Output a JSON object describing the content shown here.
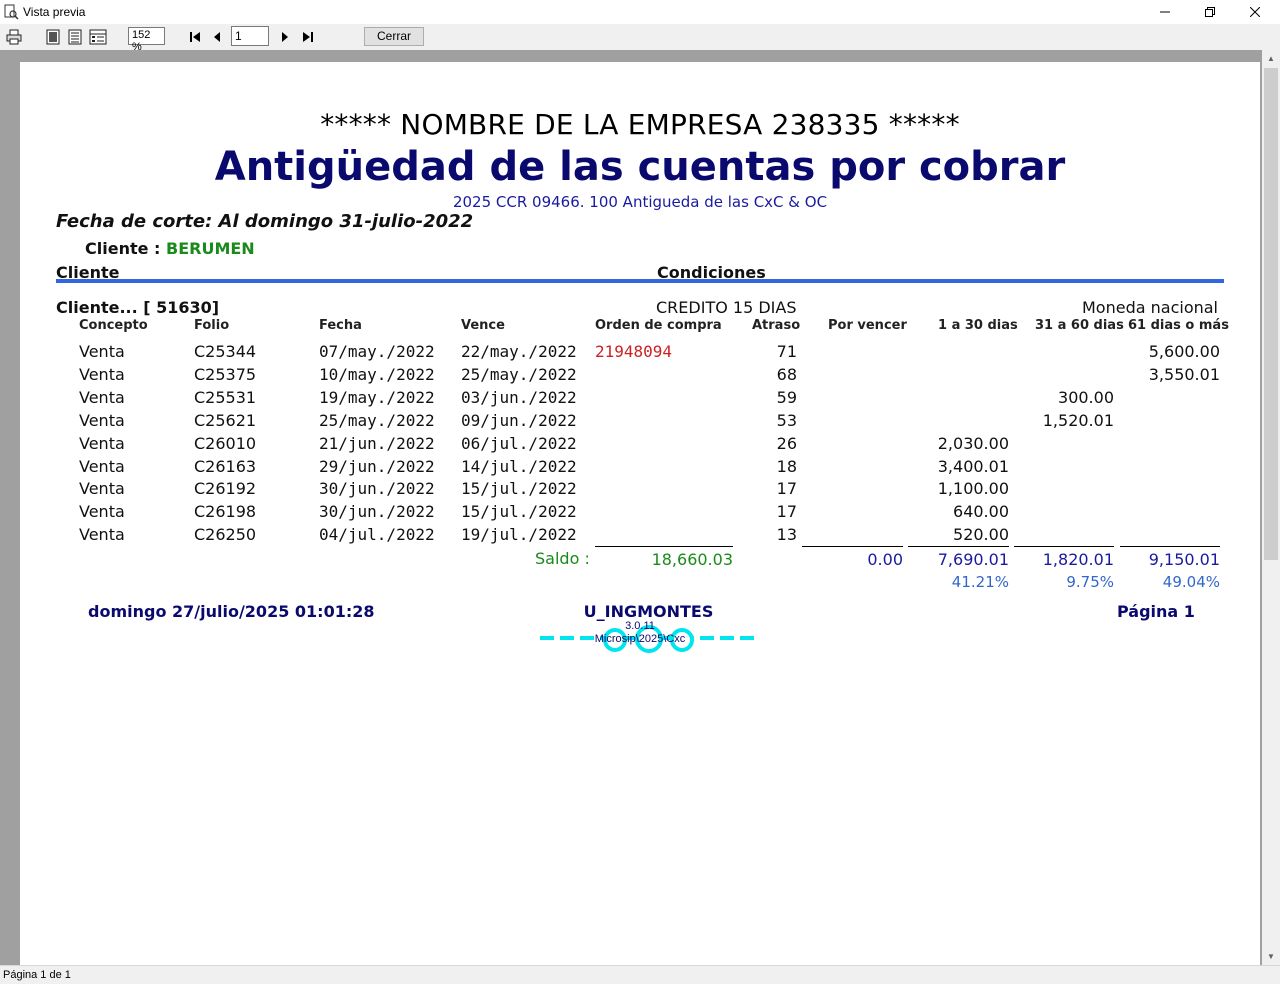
{
  "window": {
    "title": "Vista previa"
  },
  "toolbar": {
    "zoom": "152 %",
    "page_number": "1",
    "close_label": "Cerrar"
  },
  "status": {
    "text": "Página 1 de 1"
  },
  "report": {
    "company": "***** NOMBRE DE LA EMPRESA 238335 *****",
    "title": "Antigüedad de las cuentas por cobrar",
    "subtitle": "2025 CCR 09466. 100 Antigueda de las CxC & OC",
    "cutoff_date": "Fecha de corte: Al domingo 31-julio-2022",
    "client_label": "Cliente :",
    "client_value": "BERUMEN",
    "group_header_client": "Cliente",
    "group_header_conditions": "Condiciones",
    "client_number": "Cliente... [ 51630]",
    "credit_terms": "CREDITO 15 DIAS",
    "currency": "Moneda nacional",
    "columns": [
      "Concepto",
      "Folio",
      "Fecha",
      "Vence",
      "Orden de compra",
      "Atraso",
      "Por vencer",
      "1 a 30 dias",
      "31 a 60 dias",
      "61 dias o más"
    ],
    "rows": [
      {
        "concepto": "Venta",
        "folio": "C25344",
        "fecha": "07/may./2022",
        "vence": "22/may./2022",
        "orden": "21948094",
        "atraso": "71",
        "por_vencer": "",
        "d1_30": "",
        "d31_60": "",
        "d61": "5,600.00"
      },
      {
        "concepto": "Venta",
        "folio": "C25375",
        "fecha": "10/may./2022",
        "vence": "25/may./2022",
        "orden": "",
        "atraso": "68",
        "por_vencer": "",
        "d1_30": "",
        "d31_60": "",
        "d61": "3,550.01"
      },
      {
        "concepto": "Venta",
        "folio": "C25531",
        "fecha": "19/may./2022",
        "vence": "03/jun./2022",
        "orden": "",
        "atraso": "59",
        "por_vencer": "",
        "d1_30": "",
        "d31_60": "300.00",
        "d61": ""
      },
      {
        "concepto": "Venta",
        "folio": "C25621",
        "fecha": "25/may./2022",
        "vence": "09/jun./2022",
        "orden": "",
        "atraso": "53",
        "por_vencer": "",
        "d1_30": "",
        "d31_60": "1,520.01",
        "d61": ""
      },
      {
        "concepto": "Venta",
        "folio": "C26010",
        "fecha": "21/jun./2022",
        "vence": "06/jul./2022",
        "orden": "",
        "atraso": "26",
        "por_vencer": "",
        "d1_30": "2,030.00",
        "d31_60": "",
        "d61": ""
      },
      {
        "concepto": "Venta",
        "folio": "C26163",
        "fecha": "29/jun./2022",
        "vence": "14/jul./2022",
        "orden": "",
        "atraso": "18",
        "por_vencer": "",
        "d1_30": "3,400.01",
        "d31_60": "",
        "d61": ""
      },
      {
        "concepto": "Venta",
        "folio": "C26192",
        "fecha": "30/jun./2022",
        "vence": "15/jul./2022",
        "orden": "",
        "atraso": "17",
        "por_vencer": "",
        "d1_30": "1,100.00",
        "d31_60": "",
        "d61": ""
      },
      {
        "concepto": "Venta",
        "folio": "C26198",
        "fecha": "30/jun./2022",
        "vence": "15/jul./2022",
        "orden": "",
        "atraso": "17",
        "por_vencer": "",
        "d1_30": "640.00",
        "d31_60": "",
        "d61": ""
      },
      {
        "concepto": "Venta",
        "folio": "C26250",
        "fecha": "04/jul./2022",
        "vence": "19/jul./2022",
        "orden": "",
        "atraso": "13",
        "por_vencer": "",
        "d1_30": "520.00",
        "d31_60": "",
        "d61": ""
      }
    ],
    "saldo_label": "Saldo :",
    "totals": {
      "saldo": "18,660.03",
      "por_vencer": "0.00",
      "d1_30": "7,690.01",
      "d31_60": "1,820.01",
      "d61": "9,150.01"
    },
    "percents": {
      "d1_30": "41.21%",
      "d31_60": "9.75%",
      "d61": "49.04%"
    },
    "footer": {
      "datetime": "domingo 27/julio/2025 01:01:28",
      "user": "U_INGMONTES",
      "page": "Página 1",
      "version": "3.0.11",
      "path": "Microsip\\2025\\Cxc"
    },
    "logo_color": "#00e5ee"
  }
}
